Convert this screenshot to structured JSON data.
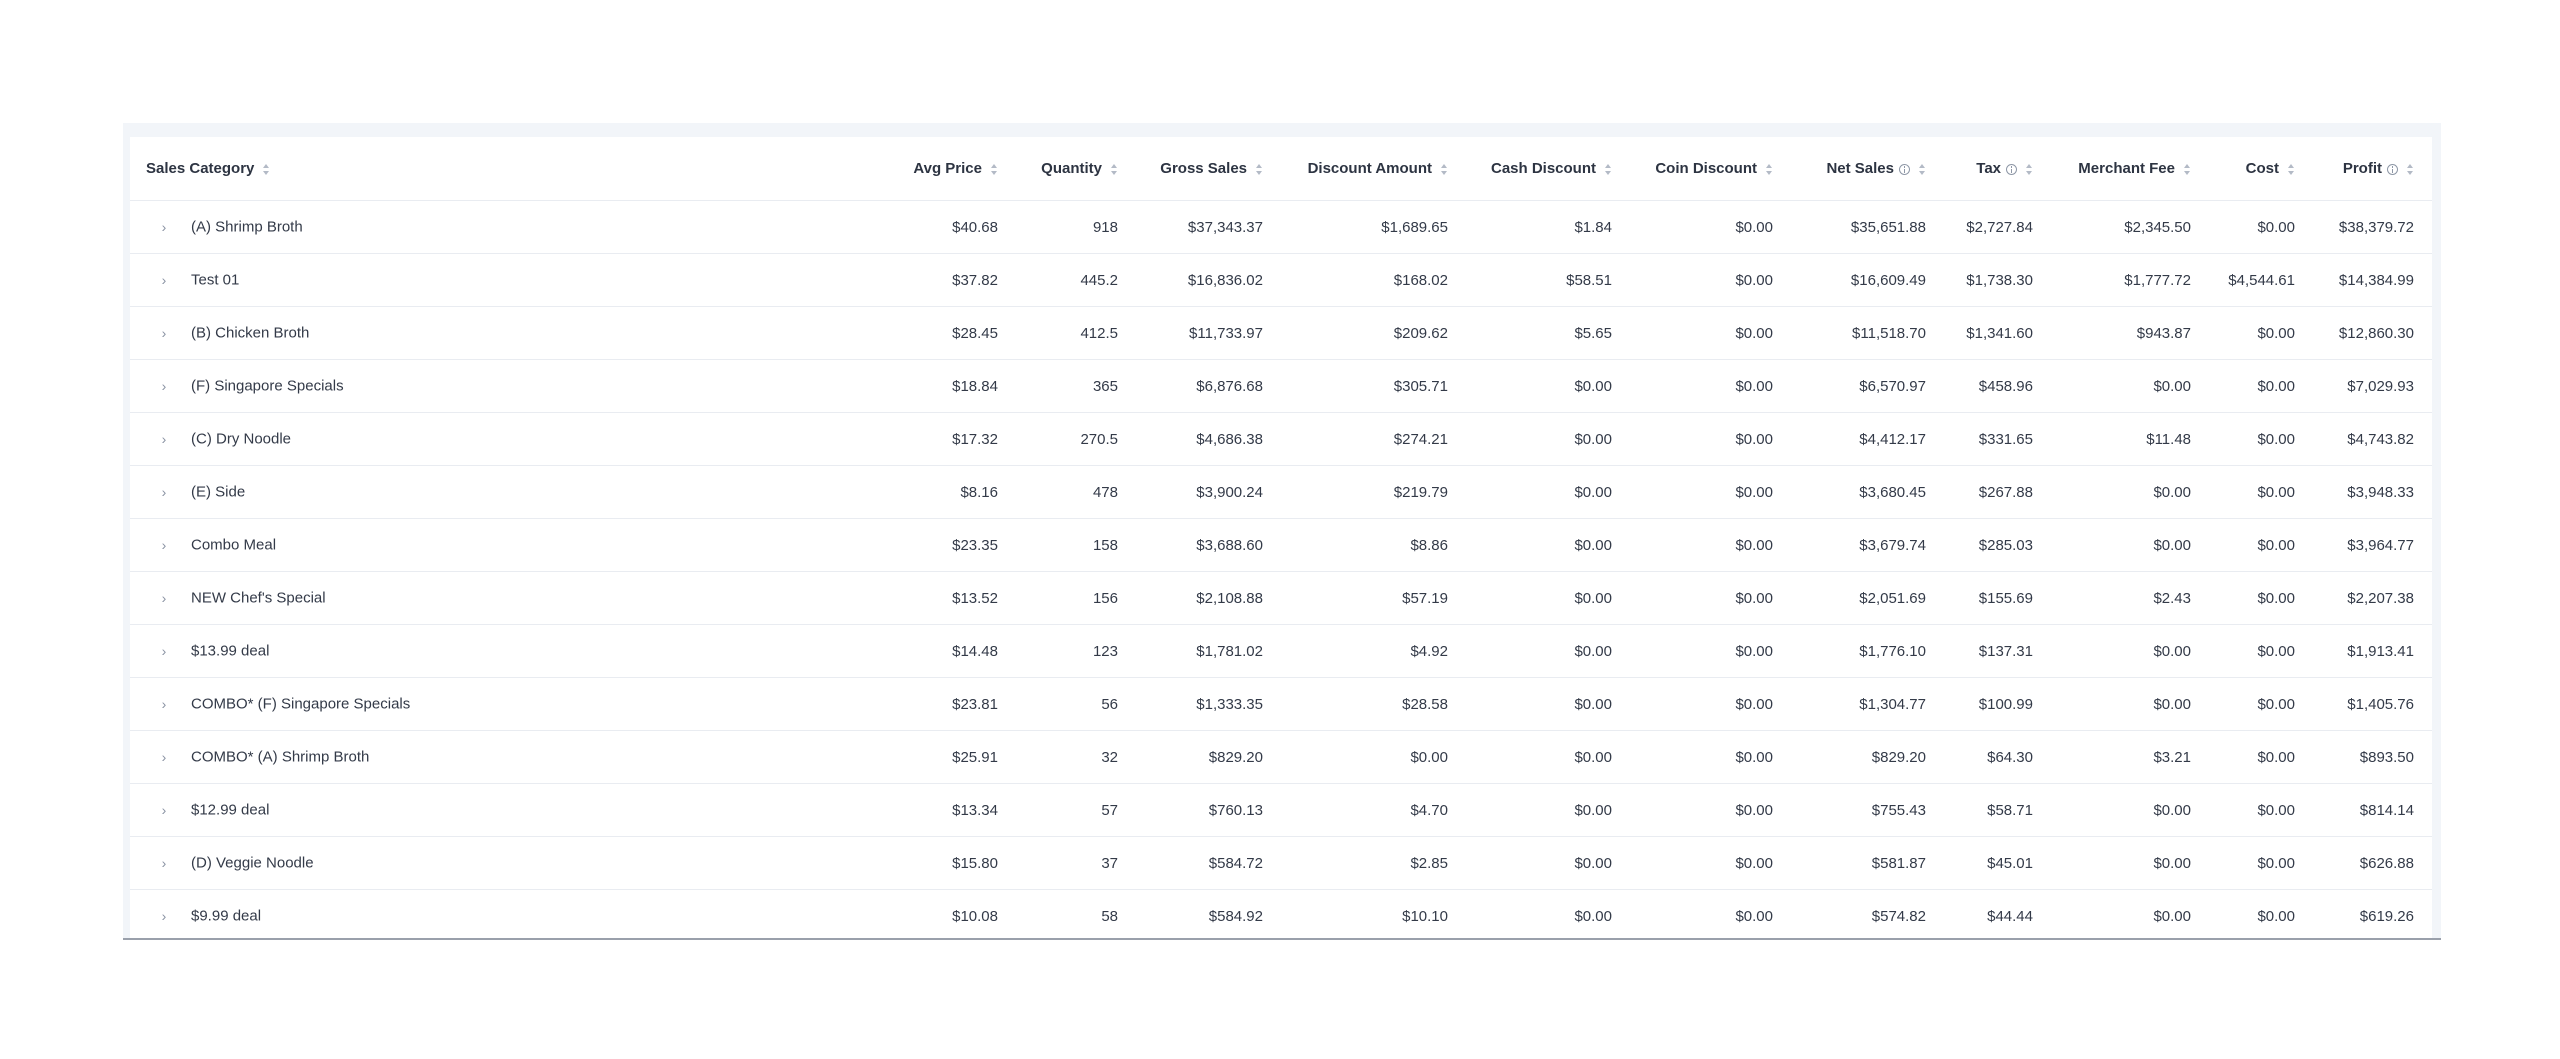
{
  "table": {
    "columns": [
      {
        "key": "category",
        "label": "Sales Category",
        "info": false
      },
      {
        "key": "avg_price",
        "label": "Avg Price",
        "info": false
      },
      {
        "key": "quantity",
        "label": "Quantity",
        "info": false
      },
      {
        "key": "gross_sales",
        "label": "Gross Sales",
        "info": false
      },
      {
        "key": "discount_amount",
        "label": "Discount Amount",
        "info": false
      },
      {
        "key": "cash_discount",
        "label": "Cash Discount",
        "info": false
      },
      {
        "key": "coin_discount",
        "label": "Coin Discount",
        "info": false
      },
      {
        "key": "net_sales",
        "label": "Net Sales",
        "info": true
      },
      {
        "key": "tax",
        "label": "Tax",
        "info": true
      },
      {
        "key": "merchant_fee",
        "label": "Merchant Fee",
        "info": false
      },
      {
        "key": "cost",
        "label": "Cost",
        "info": false
      },
      {
        "key": "profit",
        "label": "Profit",
        "info": true
      }
    ],
    "rows": [
      {
        "category": "(A) Shrimp Broth",
        "avg_price": "$40.68",
        "quantity": "918",
        "gross_sales": "$37,343.37",
        "discount_amount": "$1,689.65",
        "cash_discount": "$1.84",
        "coin_discount": "$0.00",
        "net_sales": "$35,651.88",
        "tax": "$2,727.84",
        "merchant_fee": "$2,345.50",
        "cost": "$0.00",
        "profit": "$38,379.72"
      },
      {
        "category": "Test 01",
        "avg_price": "$37.82",
        "quantity": "445.2",
        "gross_sales": "$16,836.02",
        "discount_amount": "$168.02",
        "cash_discount": "$58.51",
        "coin_discount": "$0.00",
        "net_sales": "$16,609.49",
        "tax": "$1,738.30",
        "merchant_fee": "$1,777.72",
        "cost": "$4,544.61",
        "profit": "$14,384.99"
      },
      {
        "category": "(B) Chicken Broth",
        "avg_price": "$28.45",
        "quantity": "412.5",
        "gross_sales": "$11,733.97",
        "discount_amount": "$209.62",
        "cash_discount": "$5.65",
        "coin_discount": "$0.00",
        "net_sales": "$11,518.70",
        "tax": "$1,341.60",
        "merchant_fee": "$943.87",
        "cost": "$0.00",
        "profit": "$12,860.30"
      },
      {
        "category": "(F) Singapore Specials",
        "avg_price": "$18.84",
        "quantity": "365",
        "gross_sales": "$6,876.68",
        "discount_amount": "$305.71",
        "cash_discount": "$0.00",
        "coin_discount": "$0.00",
        "net_sales": "$6,570.97",
        "tax": "$458.96",
        "merchant_fee": "$0.00",
        "cost": "$0.00",
        "profit": "$7,029.93"
      },
      {
        "category": "(C) Dry Noodle",
        "avg_price": "$17.32",
        "quantity": "270.5",
        "gross_sales": "$4,686.38",
        "discount_amount": "$274.21",
        "cash_discount": "$0.00",
        "coin_discount": "$0.00",
        "net_sales": "$4,412.17",
        "tax": "$331.65",
        "merchant_fee": "$11.48",
        "cost": "$0.00",
        "profit": "$4,743.82"
      },
      {
        "category": "(E) Side",
        "avg_price": "$8.16",
        "quantity": "478",
        "gross_sales": "$3,900.24",
        "discount_amount": "$219.79",
        "cash_discount": "$0.00",
        "coin_discount": "$0.00",
        "net_sales": "$3,680.45",
        "tax": "$267.88",
        "merchant_fee": "$0.00",
        "cost": "$0.00",
        "profit": "$3,948.33"
      },
      {
        "category": "Combo Meal",
        "avg_price": "$23.35",
        "quantity": "158",
        "gross_sales": "$3,688.60",
        "discount_amount": "$8.86",
        "cash_discount": "$0.00",
        "coin_discount": "$0.00",
        "net_sales": "$3,679.74",
        "tax": "$285.03",
        "merchant_fee": "$0.00",
        "cost": "$0.00",
        "profit": "$3,964.77"
      },
      {
        "category": "NEW Chef's Special",
        "avg_price": "$13.52",
        "quantity": "156",
        "gross_sales": "$2,108.88",
        "discount_amount": "$57.19",
        "cash_discount": "$0.00",
        "coin_discount": "$0.00",
        "net_sales": "$2,051.69",
        "tax": "$155.69",
        "merchant_fee": "$2.43",
        "cost": "$0.00",
        "profit": "$2,207.38"
      },
      {
        "category": "$13.99 deal",
        "avg_price": "$14.48",
        "quantity": "123",
        "gross_sales": "$1,781.02",
        "discount_amount": "$4.92",
        "cash_discount": "$0.00",
        "coin_discount": "$0.00",
        "net_sales": "$1,776.10",
        "tax": "$137.31",
        "merchant_fee": "$0.00",
        "cost": "$0.00",
        "profit": "$1,913.41"
      },
      {
        "category": "COMBO* (F) Singapore Specials",
        "avg_price": "$23.81",
        "quantity": "56",
        "gross_sales": "$1,333.35",
        "discount_amount": "$28.58",
        "cash_discount": "$0.00",
        "coin_discount": "$0.00",
        "net_sales": "$1,304.77",
        "tax": "$100.99",
        "merchant_fee": "$0.00",
        "cost": "$0.00",
        "profit": "$1,405.76"
      },
      {
        "category": "COMBO* (A) Shrimp Broth",
        "avg_price": "$25.91",
        "quantity": "32",
        "gross_sales": "$829.20",
        "discount_amount": "$0.00",
        "cash_discount": "$0.00",
        "coin_discount": "$0.00",
        "net_sales": "$829.20",
        "tax": "$64.30",
        "merchant_fee": "$3.21",
        "cost": "$0.00",
        "profit": "$893.50"
      },
      {
        "category": "$12.99 deal",
        "avg_price": "$13.34",
        "quantity": "57",
        "gross_sales": "$760.13",
        "discount_amount": "$4.70",
        "cash_discount": "$0.00",
        "coin_discount": "$0.00",
        "net_sales": "$755.43",
        "tax": "$58.71",
        "merchant_fee": "$0.00",
        "cost": "$0.00",
        "profit": "$814.14"
      },
      {
        "category": "(D) Veggie Noodle",
        "avg_price": "$15.80",
        "quantity": "37",
        "gross_sales": "$584.72",
        "discount_amount": "$2.85",
        "cash_discount": "$0.00",
        "coin_discount": "$0.00",
        "net_sales": "$581.87",
        "tax": "$45.01",
        "merchant_fee": "$0.00",
        "cost": "$0.00",
        "profit": "$626.88"
      },
      {
        "category": "$9.99 deal",
        "avg_price": "$10.08",
        "quantity": "58",
        "gross_sales": "$584.92",
        "discount_amount": "$10.10",
        "cash_discount": "$0.00",
        "coin_discount": "$0.00",
        "net_sales": "$574.82",
        "tax": "$44.44",
        "merchant_fee": "$0.00",
        "cost": "$0.00",
        "profit": "$619.26"
      }
    ]
  }
}
